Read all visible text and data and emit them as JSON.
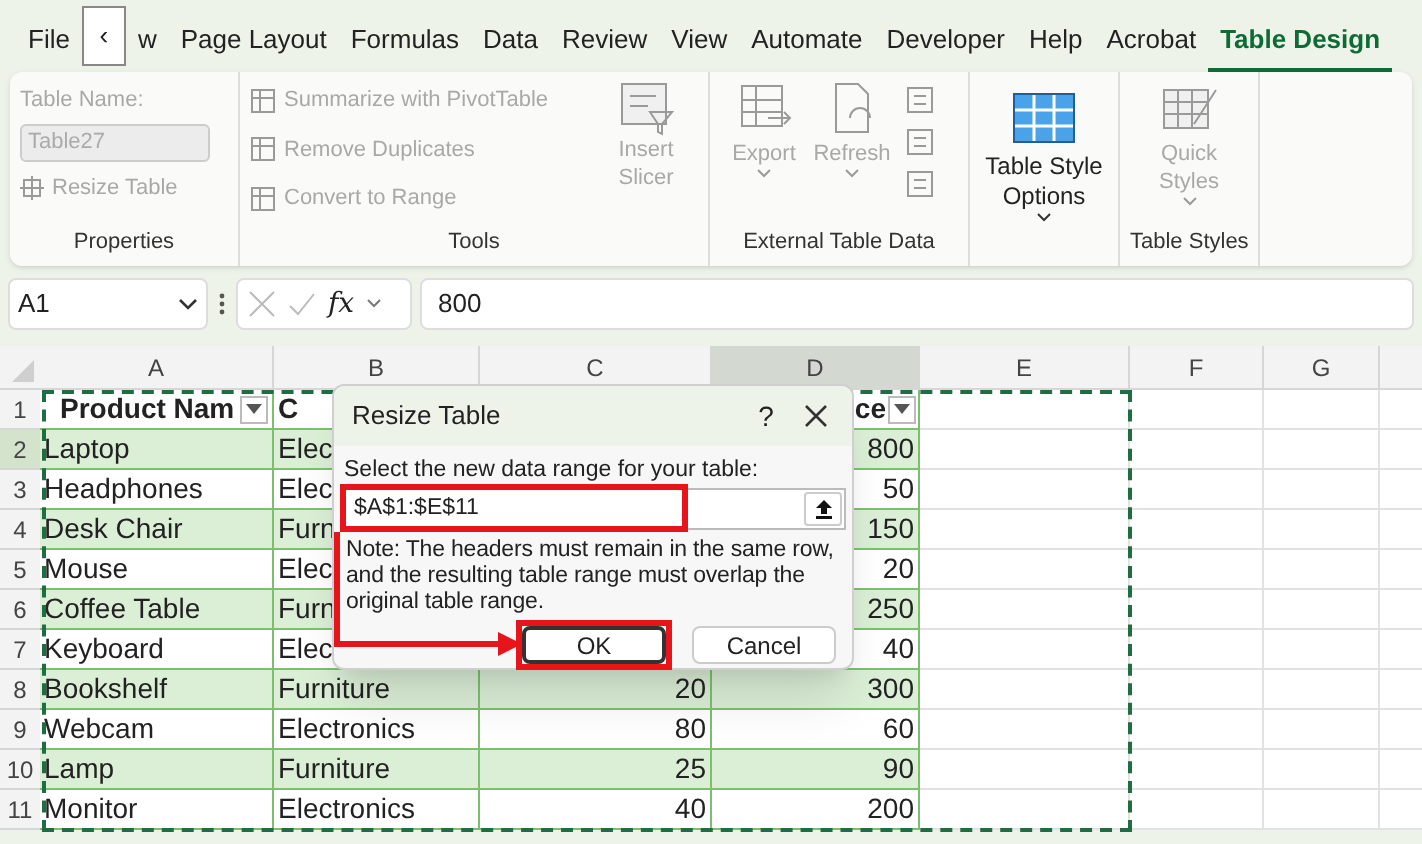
{
  "tab_scroll_button": "‹",
  "ribbon_tabs": [
    {
      "label": "File",
      "selected": false
    },
    {
      "label": "w",
      "selected": false
    },
    {
      "label": "Page Layout",
      "selected": false
    },
    {
      "label": "Formulas",
      "selected": false
    },
    {
      "label": "Data",
      "selected": false
    },
    {
      "label": "Review",
      "selected": false
    },
    {
      "label": "View",
      "selected": false
    },
    {
      "label": "Automate",
      "selected": false
    },
    {
      "label": "Developer",
      "selected": false
    },
    {
      "label": "Help",
      "selected": false
    },
    {
      "label": "Acrobat",
      "selected": false
    },
    {
      "label": "Table Design",
      "selected": true
    }
  ],
  "ribbon": {
    "properties": {
      "name_label": "Table Name:",
      "name_value": "Table27",
      "disabled": true,
      "resize": {
        "label": "Resize Table",
        "disabled": true
      },
      "group_label": "Properties"
    },
    "tools": {
      "items": [
        {
          "label": "Summarize with PivotTable",
          "disabled": true
        },
        {
          "label": "Remove Duplicates",
          "disabled": true
        },
        {
          "label": "Convert to Range",
          "disabled": true
        }
      ],
      "slicer": {
        "label": "Insert Slicer",
        "disabled": true
      },
      "group_label": "Tools"
    },
    "external": {
      "buttons": [
        {
          "label": "Export",
          "disabled": true
        },
        {
          "label": "Refresh",
          "disabled": true
        }
      ],
      "group_label": "External Table Data"
    },
    "style_options": {
      "label": "Table Style Options",
      "disabled": false
    },
    "styles": {
      "label": "Quick Styles",
      "disabled": true,
      "group_label": "Table Styles"
    }
  },
  "formula_bar": {
    "name_box": "A1",
    "fx": "fx",
    "value": "800"
  },
  "grid": {
    "columns": [
      {
        "label": "A",
        "selected": false
      },
      {
        "label": "B",
        "selected": false
      },
      {
        "label": "C",
        "selected": false
      },
      {
        "label": "D",
        "selected": true
      },
      {
        "label": "E",
        "selected": false
      },
      {
        "label": "F",
        "selected": false
      },
      {
        "label": "G",
        "selected": false
      }
    ],
    "row_numbers": [
      {
        "label": "1",
        "selected": false
      },
      {
        "label": "2",
        "selected": true
      },
      {
        "label": "3",
        "selected": false
      },
      {
        "label": "4",
        "selected": false
      },
      {
        "label": "5",
        "selected": false
      },
      {
        "label": "6",
        "selected": false
      },
      {
        "label": "7",
        "selected": false
      },
      {
        "label": "8",
        "selected": false
      },
      {
        "label": "9",
        "selected": false
      },
      {
        "label": "10",
        "selected": false
      },
      {
        "label": "11",
        "selected": false
      }
    ],
    "header": {
      "a": "Product Nam",
      "b": "C",
      "d": "ce"
    },
    "rows": [
      {
        "a": "Laptop",
        "b": "Elec",
        "d": "800"
      },
      {
        "a": "Headphones",
        "b": "Elec",
        "d": "50"
      },
      {
        "a": "Desk Chair",
        "b": "Furn",
        "d": "150"
      },
      {
        "a": "Mouse",
        "b": "Elec",
        "d": "20"
      },
      {
        "a": "Coffee Table",
        "b": "Furn",
        "d": "250"
      },
      {
        "a": "Keyboard",
        "b": "Elec",
        "d": "40"
      },
      {
        "a": "Bookshelf",
        "b": "Furniture",
        "c": "20",
        "d": "300"
      },
      {
        "a": "Webcam",
        "b": "Electronics",
        "c": "80",
        "d": "60"
      },
      {
        "a": "Lamp",
        "b": "Furniture",
        "c": "25",
        "d": "90"
      },
      {
        "a": "Monitor",
        "b": "Electronics",
        "c": "40",
        "d": "200"
      }
    ]
  },
  "dialog": {
    "title": "Resize Table",
    "help": "?",
    "prompt": "Select the new data range for your table:",
    "range": "$A$1:$E$11",
    "note": "Note: The headers must remain in the same row, and the resulting table range must overlap the original table range.",
    "buttons": [
      {
        "label": "OK",
        "selected": true
      },
      {
        "label": "Cancel",
        "selected": false
      }
    ]
  }
}
